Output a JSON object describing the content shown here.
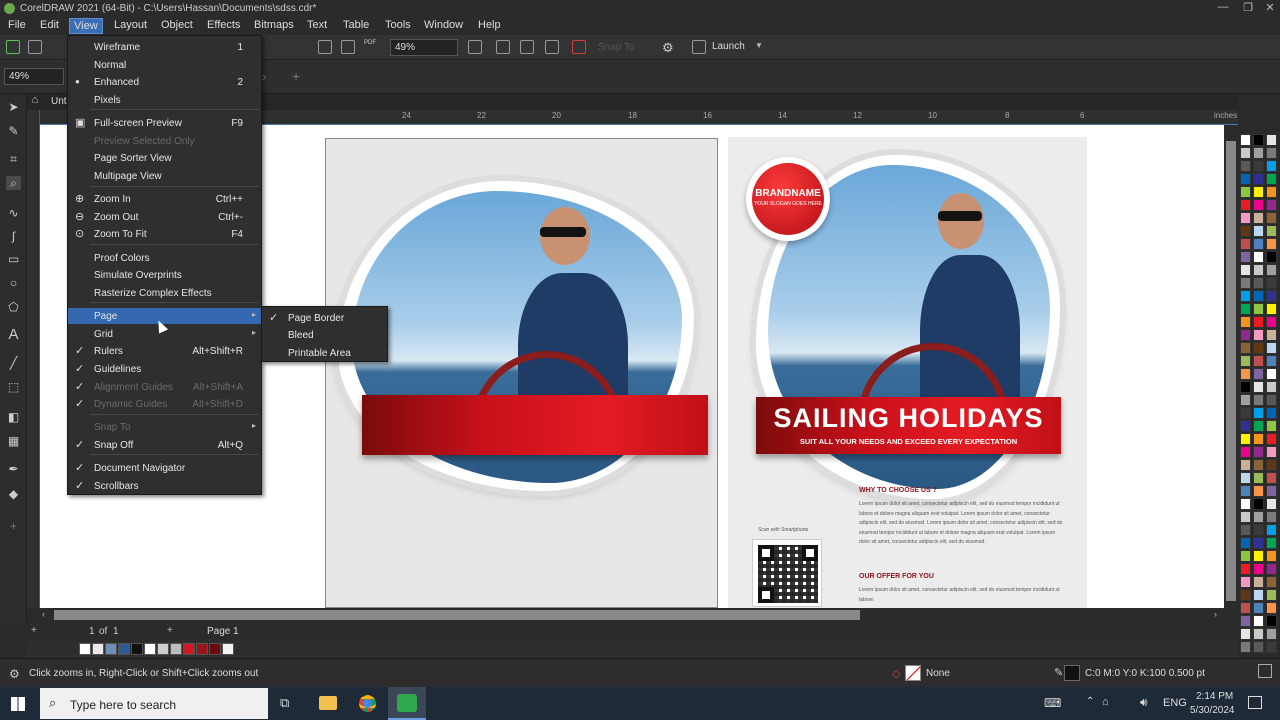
{
  "titlebar": {
    "title": "CorelDRAW 2021 (64-Bit) - C:\\Users\\Hassan\\Documents\\sdss.cdr*"
  },
  "menubar": [
    "File",
    "Edit",
    "View",
    "Layout",
    "Object",
    "Effects",
    "Bitmaps",
    "Text",
    "Table",
    "Tools",
    "Window",
    "Help"
  ],
  "toolbar": {
    "zoom_value": "49%",
    "launch_label": "Launch",
    "snap_label": "Snap To"
  },
  "propbar": {
    "zoom_value": "49%"
  },
  "doc_tab": {
    "label": "Unt"
  },
  "ruler": {
    "ticks": [
      "24",
      "22",
      "20",
      "18",
      "16",
      "14",
      "12",
      "10",
      "8",
      "6"
    ],
    "unit": "inches"
  },
  "view_menu": {
    "items": [
      {
        "label": "Wireframe",
        "shortcut": "1"
      },
      {
        "label": "Normal",
        "shortcut": ""
      },
      {
        "label": "Enhanced",
        "shortcut": "2"
      },
      {
        "label": "Pixels",
        "shortcut": ""
      },
      {
        "label": "Full-screen Preview",
        "shortcut": "F9"
      },
      {
        "label": "Preview Selected Only",
        "shortcut": ""
      },
      {
        "label": "Page Sorter View",
        "shortcut": ""
      },
      {
        "label": "Multipage View",
        "shortcut": ""
      },
      {
        "label": "Zoom In",
        "shortcut": "Ctrl++"
      },
      {
        "label": "Zoom Out",
        "shortcut": "Ctrl+-"
      },
      {
        "label": "Zoom To Fit",
        "shortcut": "F4"
      },
      {
        "label": "Proof Colors",
        "shortcut": ""
      },
      {
        "label": "Simulate Overprints",
        "shortcut": ""
      },
      {
        "label": "Rasterize Complex Effects",
        "shortcut": ""
      },
      {
        "label": "Page",
        "shortcut": ""
      },
      {
        "label": "Grid",
        "shortcut": ""
      },
      {
        "label": "Rulers",
        "shortcut": "Alt+Shift+R"
      },
      {
        "label": "Guidelines",
        "shortcut": ""
      },
      {
        "label": "Alignment Guides",
        "shortcut": "Alt+Shift+A"
      },
      {
        "label": "Dynamic Guides",
        "shortcut": "Alt+Shift+D"
      },
      {
        "label": "Snap To",
        "shortcut": ""
      },
      {
        "label": "Snap Off",
        "shortcut": "Alt+Q"
      },
      {
        "label": "Document Navigator",
        "shortcut": ""
      },
      {
        "label": "Scrollbars",
        "shortcut": ""
      }
    ]
  },
  "page_submenu": {
    "items": [
      "Page Border",
      "Bleed",
      "Printable Area"
    ]
  },
  "flyer": {
    "brand": "BRANDNAME",
    "slogan": "YOUR SLOGAN GOES HERE",
    "headline": "SAILING HOLIDAYS",
    "subline": "SUIT ALL YOUR  NEEDS AND EXCEED EVERY EXPECTATION",
    "why_title": "WHY TO CHOOSE US ?",
    "why_body": "Lorem ipsum dolor sit amet, consectetur adipiscin elit, sed do eiusmod tempor incididunt ut labore et dolore magna aliquam erat volutpat. Lorem ipsum dolor sit amet, consectetur adipiscin elit, sed do eiusmod. Lorem ipsum dolor sit amet, consectetur adipiscin elit, sed do eiusmod tempor incididunt ut labore et dolore magna aliquam erat volutpat. Lorem ipsum dolor sit amet, consectetur adipiscin elit, sed do eiusmod.",
    "offer_title": "OUR OFFER FOR YOU",
    "offer_body": "Lorem ipsum dolor sit amet, consectetur adipiscin elit, sed do eiusmod tempor incididunt ut labore:",
    "qr_caption": "Scan with Smartphone"
  },
  "page_nav": {
    "current": "1",
    "of_label": "of",
    "total": "1",
    "page_tab": "Page 1"
  },
  "status": {
    "hint": "Click zooms in, Right-Click or Shift+Click zooms out",
    "fill_label": "None",
    "outline_info": "C:0 M:0 Y:0 K:100  0.500 pt"
  },
  "taskbar": {
    "search_placeholder": "Type here to search",
    "time": "2:14 PM",
    "date": "5/30/2024",
    "lang": "ENG"
  },
  "colors": {
    "accent": "#3a6fb6",
    "red": "#d11820",
    "dark_red": "#7a0b0b"
  },
  "palette_colors": [
    "#ffffff",
    "#000000",
    "#e5e5e5",
    "#c9c9c9",
    "#a0a0a0",
    "#7a7a7a",
    "#595959",
    "#3a3a3a",
    "#00a0e9",
    "#0066b3",
    "#2e3192",
    "#00a651",
    "#8dc63f",
    "#fff200",
    "#f7941d",
    "#ed1c24",
    "#ec008c",
    "#92278f",
    "#f49ac1",
    "#c7b299",
    "#8c6239",
    "#603813",
    "#bdd7ee",
    "#9bbb59",
    "#c0504d",
    "#4f81bd",
    "#f79646",
    "#8064a2"
  ],
  "doc_palette": [
    "#ffffff",
    "#e8e8e8",
    "#6d8fb8",
    "#2e5b94",
    "#111111",
    "#ffffff",
    "#cfcfcf",
    "#bdbdbd",
    "#d11820",
    "#9b1218",
    "#6b0a0e",
    "#f2f2f2"
  ]
}
